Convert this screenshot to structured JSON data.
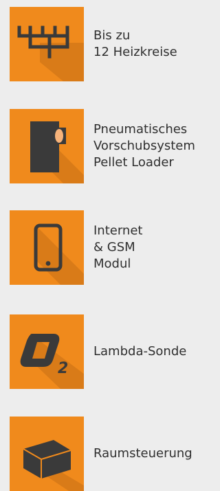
{
  "features": [
    {
      "icon": "heating-circuits-icon",
      "lines": [
        "Bis zu",
        "12 Heizkreise"
      ]
    },
    {
      "icon": "pellet-loader-icon",
      "lines": [
        "Pneumatisches",
        "Vorschubsystem",
        "Pellet Loader"
      ]
    },
    {
      "icon": "smartphone-icon",
      "lines": [
        "Internet",
        "& GSM",
        "Modul"
      ]
    },
    {
      "icon": "lambda-sensor-icon",
      "lines": [
        "Lambda-Sonde"
      ]
    },
    {
      "icon": "room-control-icon",
      "lines": [
        "Raumsteuerung"
      ]
    }
  ],
  "colors": {
    "tile_orange": "#f08a1c",
    "tile_shadow": "#c76f16",
    "icon_dark": "#3a3a3a",
    "icon_light": "#f7b37a",
    "background": "#ededed"
  }
}
